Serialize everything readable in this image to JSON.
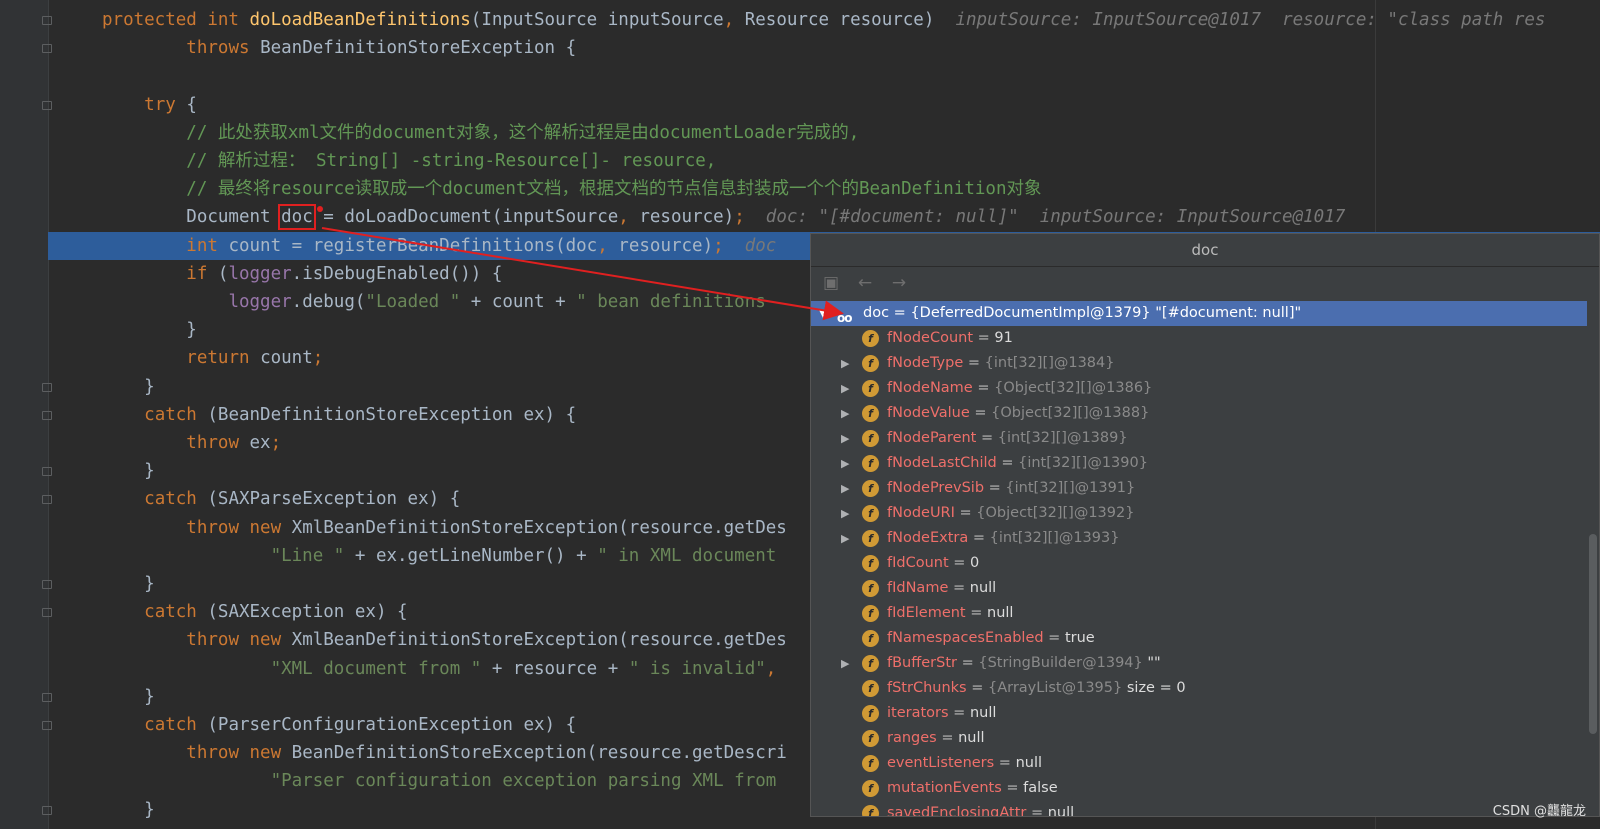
{
  "editor": {
    "lines": [
      [
        {
          "t": "protected ",
          "c": "kw"
        },
        {
          "t": "int ",
          "c": "kw"
        },
        {
          "t": "doLoadBeanDefinitions",
          "c": "fn"
        },
        {
          "t": "(InputSource inputSource"
        },
        {
          "t": ", ",
          "c": "kw"
        },
        {
          "t": "Resource resource)  "
        },
        {
          "t": "inputSource: InputSource@1017  resource: \"class path res",
          "c": "hint"
        }
      ],
      [
        {
          "t": "        "
        },
        {
          "t": "throws ",
          "c": "kw"
        },
        {
          "t": "BeanDefinitionStoreException {"
        }
      ],
      [
        {
          "t": ""
        }
      ],
      [
        {
          "t": "    "
        },
        {
          "t": "try ",
          "c": "kw"
        },
        {
          "t": "{"
        }
      ],
      [
        {
          "t": "        "
        },
        {
          "t": "// 此处获取xml文件的document对象，这个解析过程是由documentLoader完成的,",
          "c": "cmt"
        }
      ],
      [
        {
          "t": "        "
        },
        {
          "t": "// 解析过程： String[] -string-Resource[]- resource,",
          "c": "cmt"
        }
      ],
      [
        {
          "t": "        "
        },
        {
          "t": "// 最终将resource读取成一个document文档，根据文档的节点信息封装成一个个的BeanDefinition对象",
          "c": "cmt"
        }
      ],
      [
        {
          "t": "        Document "
        },
        {
          "t": "doc",
          "c": "boxed"
        },
        {
          "t": " = doLoadDocument(inputSource"
        },
        {
          "t": ", ",
          "c": "kw"
        },
        {
          "t": "resource)"
        },
        {
          "t": ";  ",
          "c": "kw"
        },
        {
          "t": "doc: \"[#document: null]\"  inputSource: InputSource@1017",
          "c": "hint"
        }
      ],
      [
        {
          "t": "        "
        },
        {
          "t": "int ",
          "c": "kw"
        },
        {
          "t": "count = registerBeanDefinitions(doc"
        },
        {
          "t": ", ",
          "c": "kw"
        },
        {
          "t": "resource)"
        },
        {
          "t": ";  ",
          "c": "kw"
        },
        {
          "t": "doc",
          "c": "hint"
        }
      ],
      [
        {
          "t": "        "
        },
        {
          "t": "if ",
          "c": "kw"
        },
        {
          "t": "("
        },
        {
          "t": "logger",
          "c": "fld"
        },
        {
          "t": ".isDebugEnabled()) {"
        }
      ],
      [
        {
          "t": "            "
        },
        {
          "t": "logger",
          "c": "fld"
        },
        {
          "t": ".debug("
        },
        {
          "t": "\"Loaded \" ",
          "c": "str"
        },
        {
          "t": "+ count + "
        },
        {
          "t": "\" bean definitions ",
          "c": "str"
        }
      ],
      [
        {
          "t": "        }"
        }
      ],
      [
        {
          "t": "        "
        },
        {
          "t": "return ",
          "c": "kw"
        },
        {
          "t": "count"
        },
        {
          "t": ";",
          "c": "kw"
        }
      ],
      [
        {
          "t": "    }"
        }
      ],
      [
        {
          "t": "    "
        },
        {
          "t": "catch ",
          "c": "kw"
        },
        {
          "t": "(BeanDefinitionStoreException ex) {"
        }
      ],
      [
        {
          "t": "        "
        },
        {
          "t": "throw ",
          "c": "kw"
        },
        {
          "t": "ex"
        },
        {
          "t": ";",
          "c": "kw"
        }
      ],
      [
        {
          "t": "    }"
        }
      ],
      [
        {
          "t": "    "
        },
        {
          "t": "catch ",
          "c": "kw"
        },
        {
          "t": "(SAXParseException ex) {"
        }
      ],
      [
        {
          "t": "        "
        },
        {
          "t": "throw new ",
          "c": "kw"
        },
        {
          "t": "XmlBeanDefinitionStoreException(resource.getDes"
        }
      ],
      [
        {
          "t": "                "
        },
        {
          "t": "\"Line \" ",
          "c": "str"
        },
        {
          "t": "+ ex.getLineNumber() + "
        },
        {
          "t": "\" in XML document ",
          "c": "str"
        }
      ],
      [
        {
          "t": "    }"
        }
      ],
      [
        {
          "t": "    "
        },
        {
          "t": "catch ",
          "c": "kw"
        },
        {
          "t": "(SAXException ex) {"
        }
      ],
      [
        {
          "t": "        "
        },
        {
          "t": "throw new ",
          "c": "kw"
        },
        {
          "t": "XmlBeanDefinitionStoreException(resource.getDes"
        }
      ],
      [
        {
          "t": "                "
        },
        {
          "t": "\"XML document from \" ",
          "c": "str"
        },
        {
          "t": "+ resource + "
        },
        {
          "t": "\" is invalid\"",
          "c": "str"
        },
        {
          "t": ",",
          "c": "kw"
        }
      ],
      [
        {
          "t": "    }"
        }
      ],
      [
        {
          "t": "    "
        },
        {
          "t": "catch ",
          "c": "kw"
        },
        {
          "t": "(ParserConfigurationException ex) {"
        }
      ],
      [
        {
          "t": "        "
        },
        {
          "t": "throw new ",
          "c": "kw"
        },
        {
          "t": "BeanDefinitionStoreException(resource.getDescri"
        }
      ],
      [
        {
          "t": "                "
        },
        {
          "t": "\"Parser configuration exception parsing XML from ",
          "c": "str"
        }
      ],
      [
        {
          "t": "    }"
        }
      ]
    ],
    "highlighted_line": 8
  },
  "popup": {
    "title": "doc",
    "toolbar": [
      "restore-icon",
      "back-arrow-icon",
      "forward-arrow-icon"
    ],
    "rows": [
      {
        "sel": true,
        "expandable": true,
        "expanded": true,
        "name": "doc",
        "type": "{DeferredDocumentImpl@1379}",
        "value": "\"[#document: null]\""
      },
      {
        "expandable": false,
        "name": "fNodeCount",
        "type": "",
        "value": "91"
      },
      {
        "expandable": true,
        "name": "fNodeType",
        "type": "{int[32][]@1384}",
        "value": ""
      },
      {
        "expandable": true,
        "name": "fNodeName",
        "type": "{Object[32][]@1386}",
        "value": ""
      },
      {
        "expandable": true,
        "name": "fNodeValue",
        "type": "{Object[32][]@1388}",
        "value": ""
      },
      {
        "expandable": true,
        "name": "fNodeParent",
        "type": "{int[32][]@1389}",
        "value": ""
      },
      {
        "expandable": true,
        "name": "fNodeLastChild",
        "type": "{int[32][]@1390}",
        "value": ""
      },
      {
        "expandable": true,
        "name": "fNodePrevSib",
        "type": "{int[32][]@1391}",
        "value": ""
      },
      {
        "expandable": true,
        "name": "fNodeURI",
        "type": "{Object[32][]@1392}",
        "value": ""
      },
      {
        "expandable": true,
        "name": "fNodeExtra",
        "type": "{int[32][]@1393}",
        "value": ""
      },
      {
        "expandable": false,
        "name": "fIdCount",
        "type": "",
        "value": "0"
      },
      {
        "expandable": false,
        "name": "fIdName",
        "type": "",
        "value": "null"
      },
      {
        "expandable": false,
        "name": "fIdElement",
        "type": "",
        "value": "null"
      },
      {
        "expandable": false,
        "name": "fNamespacesEnabled",
        "type": "",
        "value": "true"
      },
      {
        "expandable": true,
        "name": "fBufferStr",
        "type": "{StringBuilder@1394}",
        "value": "\"\""
      },
      {
        "expandable": false,
        "name": "fStrChunks",
        "type": "{ArrayList@1395}",
        "value": " size = 0"
      },
      {
        "expandable": false,
        "name": "iterators",
        "type": "",
        "value": "null"
      },
      {
        "expandable": false,
        "name": "ranges",
        "type": "",
        "value": "null"
      },
      {
        "expandable": false,
        "name": "eventListeners",
        "type": "",
        "value": "null"
      },
      {
        "expandable": false,
        "name": "mutationEvents",
        "type": "",
        "value": "false"
      },
      {
        "expandable": false,
        "name": "savedEnclosingAttr",
        "type": "",
        "value": "null"
      }
    ]
  },
  "field_badge": "f",
  "watermark": "CSDN @龘龍龙",
  "colors": {
    "keyword": "#cc7832",
    "method": "#ffc66d",
    "comment": "#629755",
    "string": "#6a8759",
    "field_name": "#ee6f6a",
    "selection": "#4b6eaf",
    "annotation_box": "#e02020"
  }
}
